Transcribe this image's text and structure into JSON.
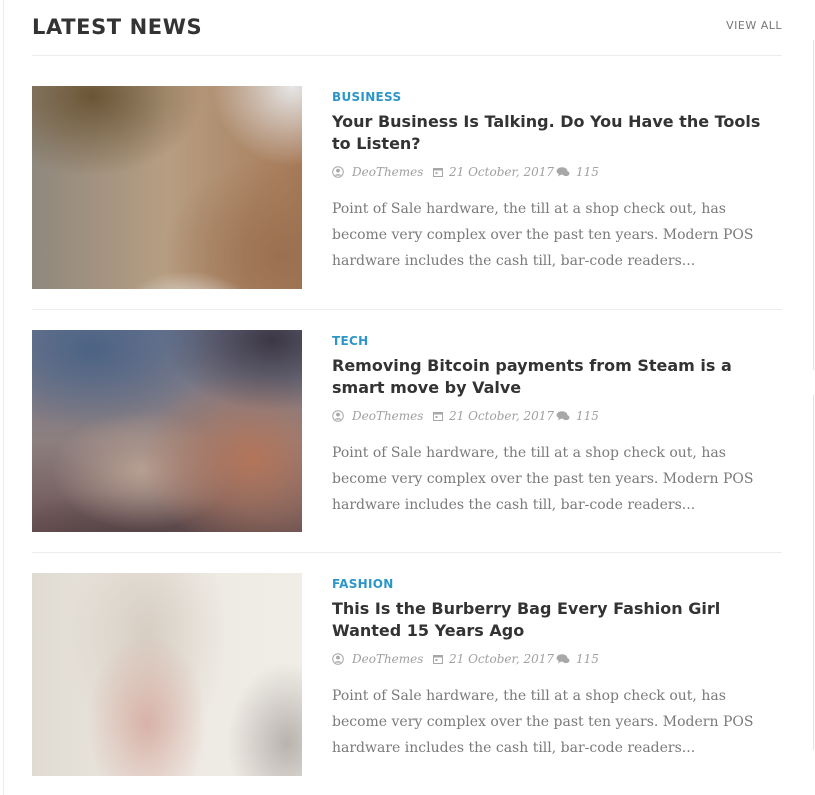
{
  "section": {
    "title": "LATEST NEWS",
    "view_all_label": "VIEW ALL"
  },
  "articles": [
    {
      "category": "BUSINESS",
      "title": "Your Business Is Talking. Do You Have the Tools to Listen?",
      "author": "DeoThemes",
      "date": "21 October, 2017",
      "comments": "115",
      "excerpt": "Point of Sale hardware, the till at a shop check out, has become very complex over the past ten years. Modern POS hardware includes the cash till, bar-code readers..."
    },
    {
      "category": "TECH",
      "title": "Removing Bitcoin payments from Steam is a smart move by Valve",
      "author": "DeoThemes",
      "date": "21 October, 2017",
      "comments": "115",
      "excerpt": "Point of Sale hardware, the till at a shop check out, has become very complex over the past ten years. Modern POS hardware includes the cash till, bar-code readers..."
    },
    {
      "category": "FASHION",
      "title": "This Is the Burberry Bag Every Fashion Girl Wanted 15 Years Ago",
      "author": "DeoThemes",
      "date": "21 October, 2017",
      "comments": "115",
      "excerpt": "Point of Sale hardware, the till at a shop check out, has become very complex over the past ten years. Modern POS hardware includes the cash till, bar-code readers..."
    }
  ],
  "colors": {
    "category_accent": "#2d96c9",
    "title_text": "#333333",
    "meta_text": "#a0a0a0",
    "excerpt_text": "#7a7a7a",
    "divider": "#ececec"
  }
}
